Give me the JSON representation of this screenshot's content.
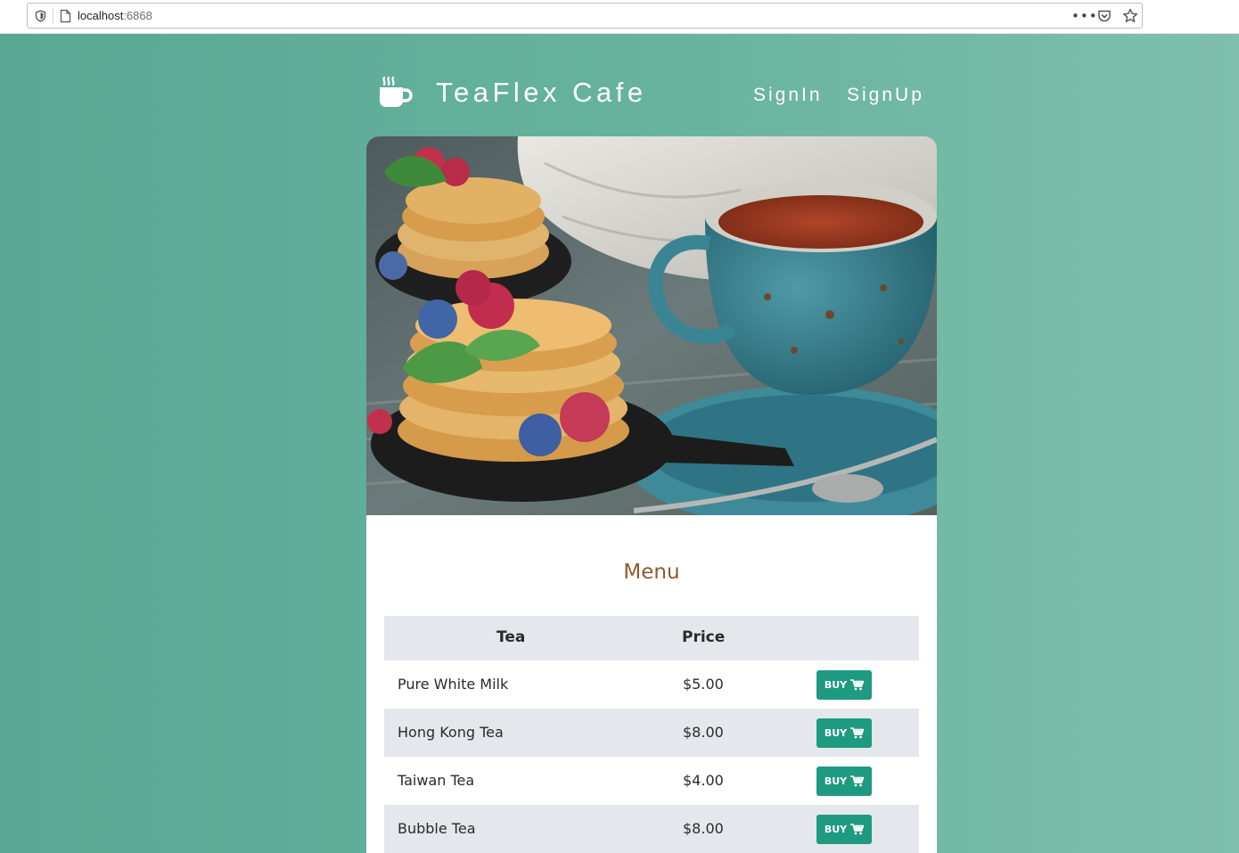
{
  "browser": {
    "url_host": "localhost",
    "url_port": ":6868",
    "more_icon": "•••"
  },
  "header": {
    "brand_icon": "coffee-cup-icon",
    "brand_title": "TeaFlex Cafe",
    "nav": [
      {
        "label": "SignIn"
      },
      {
        "label": "SignUp"
      }
    ]
  },
  "menu": {
    "title": "Menu",
    "columns": [
      "Tea",
      "Price"
    ],
    "rows": [
      {
        "name": "Pure White Milk",
        "price": "$5.00",
        "button": "BUY"
      },
      {
        "name": "Hong Kong Tea",
        "price": "$8.00",
        "button": "BUY"
      },
      {
        "name": "Taiwan Tea",
        "price": "$4.00",
        "button": "BUY"
      },
      {
        "name": "Bubble Tea",
        "price": "$8.00",
        "button": "BUY"
      }
    ]
  },
  "colors": {
    "background": "#66b29d",
    "accent_button": "#1e9a80",
    "menu_title": "#8a5d2e",
    "table_header": "#e4e7ec"
  }
}
